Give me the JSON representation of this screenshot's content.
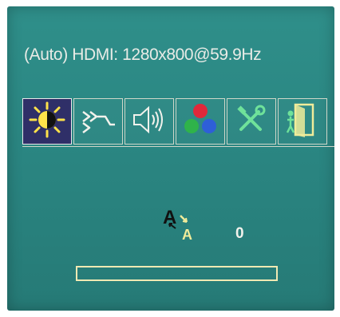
{
  "osd": {
    "status_text": "(Auto) HDMI: 1280x800@59.9Hz"
  },
  "tabs": [
    {
      "icon": "brightness-contrast-icon",
      "selected": true
    },
    {
      "icon": "input-source-icon",
      "selected": false
    },
    {
      "icon": "audio-volume-icon",
      "selected": false
    },
    {
      "icon": "color-settings-icon",
      "selected": false
    },
    {
      "icon": "tools-settings-icon",
      "selected": false
    },
    {
      "icon": "exit-icon",
      "selected": false
    }
  ],
  "adjustment": {
    "icon": "contrast-adjust-icon",
    "value_label": "0",
    "slider_level": 0
  },
  "colors": {
    "osd_background": "#2a8581",
    "selected_tab": "#2f2f68",
    "highlight": "#efe9b3",
    "text": "#e8ebe6"
  }
}
